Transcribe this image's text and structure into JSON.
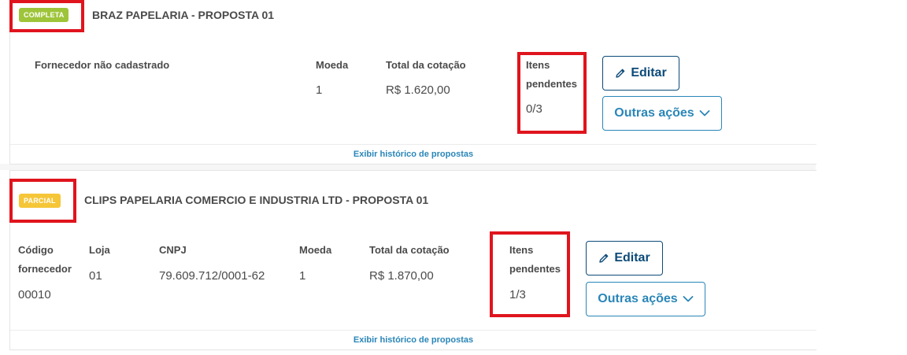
{
  "proposals": [
    {
      "status": "COMPLETA",
      "title": "BRAZ PAPELARIA - PROPOSTA 01",
      "supplier_note": "Fornecedor não cadastrado",
      "currency_label": "Moeda",
      "currency_value": "1",
      "total_label": "Total da cotação",
      "total_value": "R$ 1.620,00",
      "pending_label_1": "Itens",
      "pending_label_2": "pendentes",
      "pending_value": "0/3",
      "edit_label": "Editar",
      "more_label": "Outras ações",
      "history_link": "Exibir histórico de propostas"
    },
    {
      "status": "PARCIAL",
      "title": "CLIPS PAPELARIA COMERCIO E INDUSTRIA LTD - PROPOSTA 01",
      "code_label_1": "Código",
      "code_label_2": "fornecedor",
      "code_value": "00010",
      "store_label": "Loja",
      "store_value": "01",
      "cnpj_label": "CNPJ",
      "cnpj_value": "79.609.712/0001-62",
      "currency_label": "Moeda",
      "currency_value": "1",
      "total_label": "Total da cotação",
      "total_value": "R$ 1.870,00",
      "pending_label_1": "Itens",
      "pending_label_2": "pendentes",
      "pending_value": "1/3",
      "edit_label": "Editar",
      "more_label": "Outras ações",
      "history_link": "Exibir histórico de propostas"
    }
  ],
  "colors": {
    "complete_badge": "#9ec439",
    "partial_badge": "#f5c638",
    "highlight_box": "#e0141d",
    "primary": "#0c4a78",
    "link": "#2a86b8"
  },
  "icons": {
    "edit": "pencil-icon",
    "more": "chevron-down-icon"
  }
}
